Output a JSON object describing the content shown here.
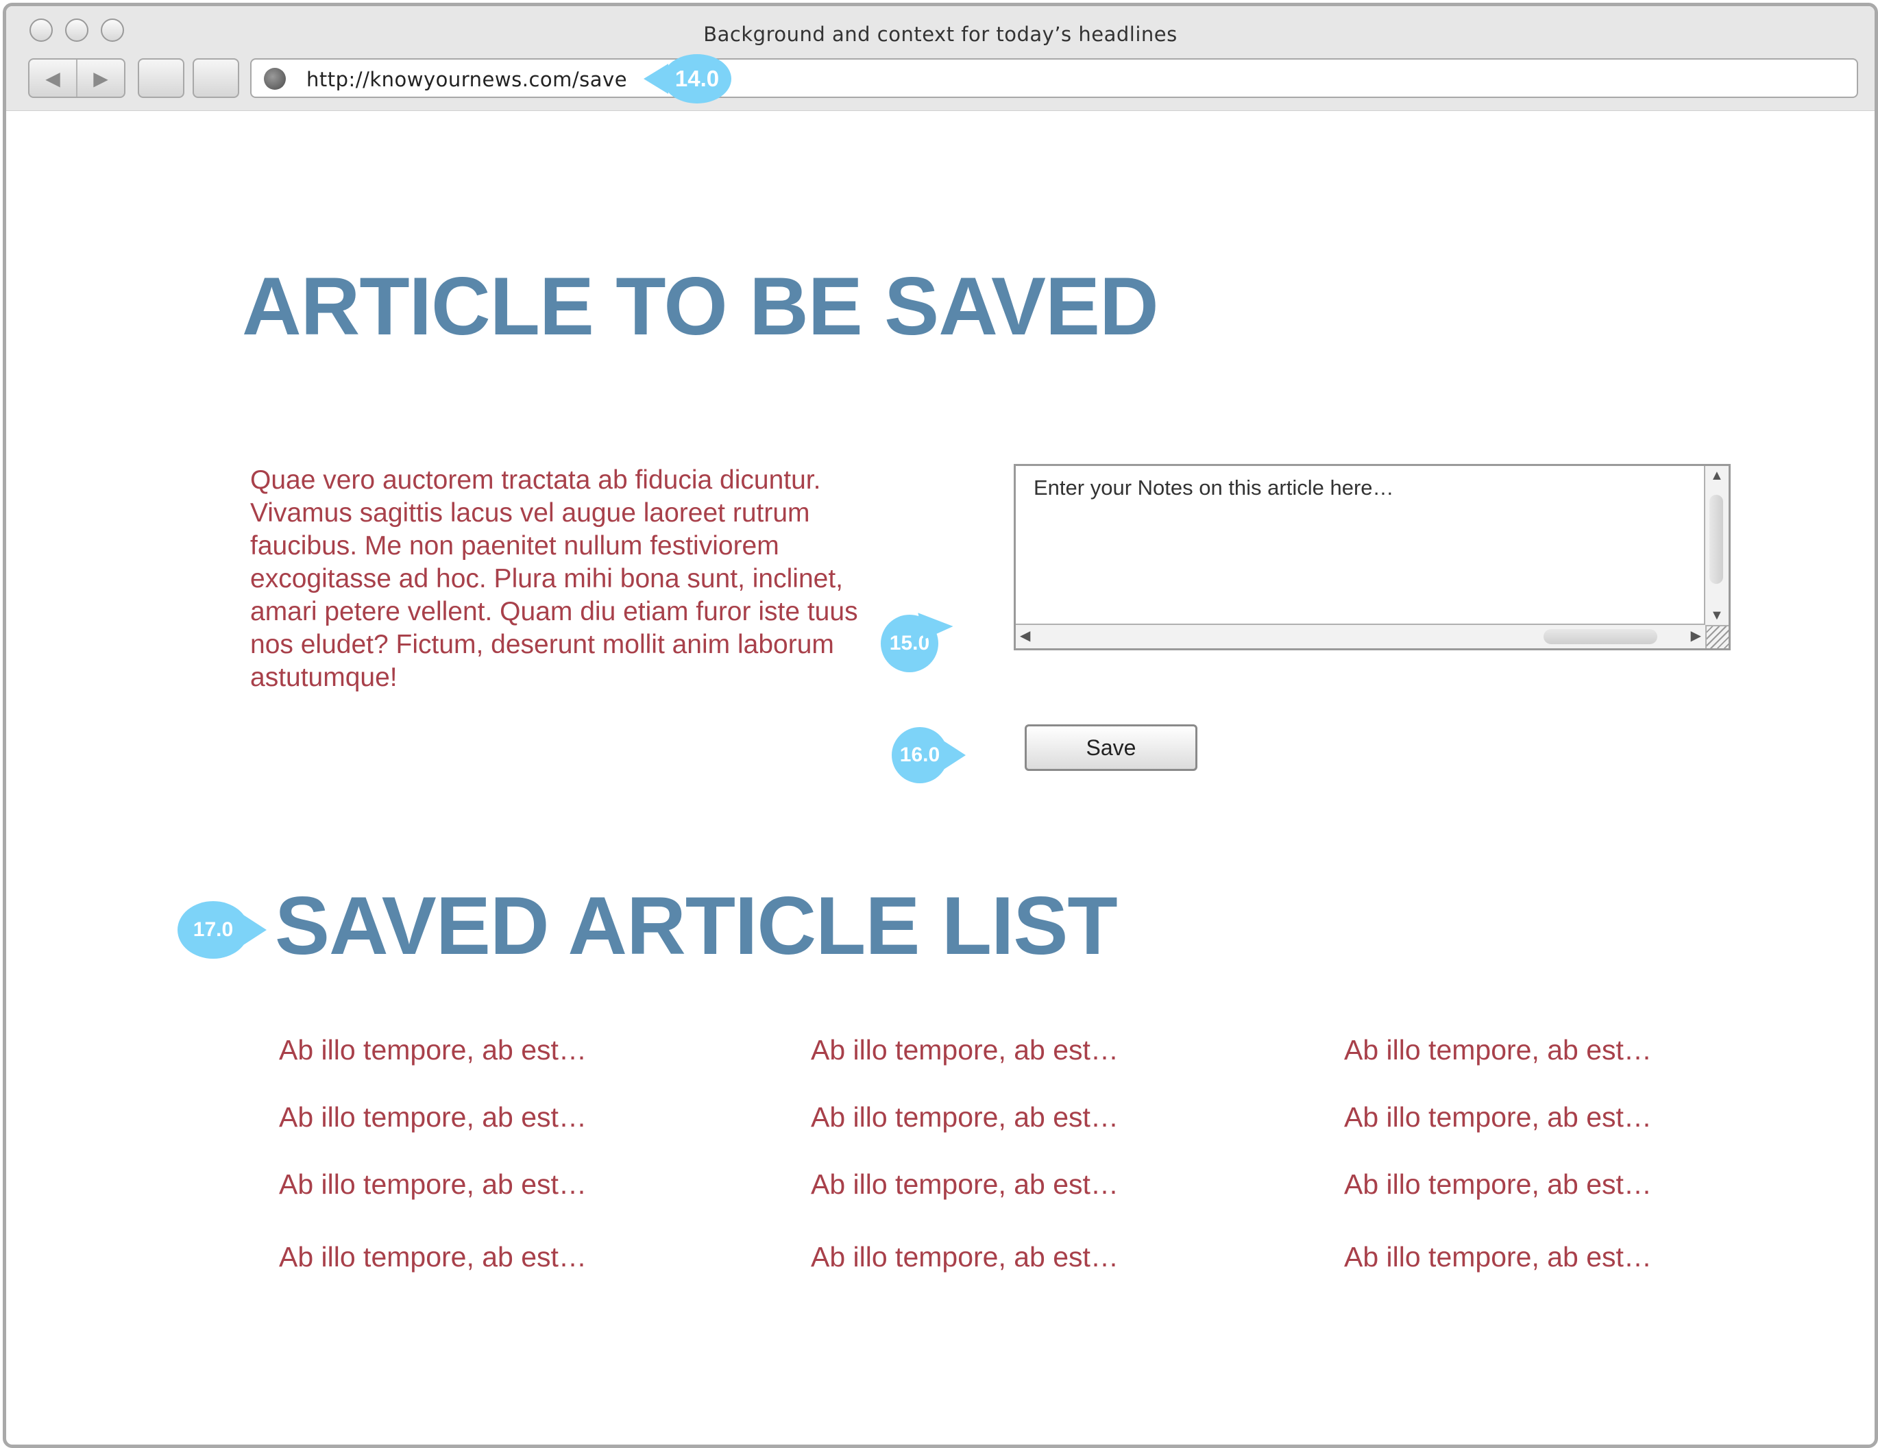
{
  "window": {
    "title": "Background and context for today’s headlines"
  },
  "toolbar": {
    "back_icon": "◀",
    "forward_icon": "▶",
    "url": "http://knowyournews.com/save"
  },
  "annotations": {
    "url_marker": "14.0",
    "notes_marker": "15.0",
    "save_marker": "16.0",
    "list_marker": "17.0"
  },
  "article": {
    "heading": "ARTICLE TO BE SAVED",
    "body": "Quae vero auctorem tractata ab fiducia dicuntur. Vivamus sagittis lacus vel augue laoreet rutrum faucibus. Me non paenitet nullum festiviorem excogitasse ad hoc. Plura mihi bona sunt, inclinet, amari petere vellent. Quam diu etiam furor iste tuus nos eludet? Fictum, deserunt mollit anim laborum astutumque!"
  },
  "notes": {
    "placeholder": "Enter your Notes on this article here…",
    "scroll_up": "▲",
    "scroll_down": "▼",
    "scroll_left": "◀",
    "scroll_right": "▶"
  },
  "save_button": {
    "label": "Save"
  },
  "saved_list": {
    "heading": "SAVED ARTICLE LIST",
    "items": [
      "Ab illo tempore, ab est…",
      "Ab illo tempore, ab est…",
      "Ab illo tempore, ab est…",
      "Ab illo tempore, ab est…",
      "Ab illo tempore, ab est…",
      "Ab illo tempore, ab est…",
      "Ab illo tempore, ab est…",
      "Ab illo tempore, ab est…",
      "Ab illo tempore, ab est…",
      "Ab illo tempore, ab est…",
      "Ab illo tempore, ab est…",
      "Ab illo tempore, ab est…"
    ]
  },
  "colors": {
    "heading": "#5a87aa",
    "body_text": "#a8404a",
    "marker": "#7dd3f8"
  }
}
